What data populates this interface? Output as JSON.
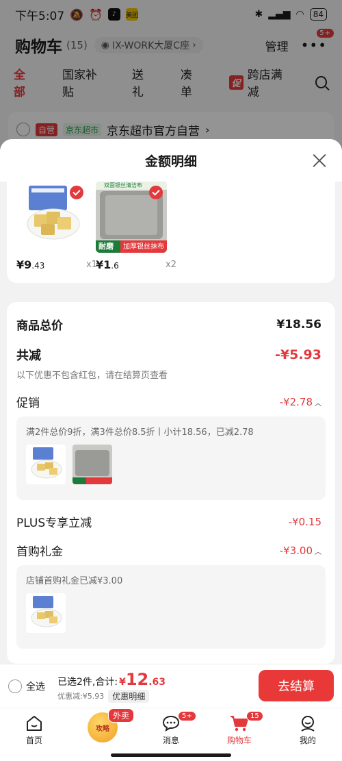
{
  "status_bar": {
    "time": "下午5:07",
    "app_badge": "美团",
    "battery": "84"
  },
  "cart": {
    "title": "购物车",
    "count": "(15)",
    "address": "IX-WORK大厦C座",
    "manage": "管理",
    "more_badge": "5+"
  },
  "tabs": [
    {
      "label": "全部"
    },
    {
      "label": "国家补贴"
    },
    {
      "label": "送礼"
    },
    {
      "label": "凑单"
    },
    {
      "label": "跨店满减",
      "tag": "促"
    }
  ],
  "store": {
    "tag_self": "自营",
    "tag_super": "京东超市",
    "name": "京东超市官方自营"
  },
  "sheet": {
    "title": "金额明细",
    "products": [
      {
        "price_int": "¥9",
        "price_dec": ".43",
        "qty": "x1"
      },
      {
        "price_int": "¥1",
        "price_dec": ".6",
        "qty": "x2",
        "label_left": "耐磨",
        "label_right": "加厚银丝抹布",
        "img_text": "双面银丝清洁布"
      }
    ],
    "total_label": "商品总价",
    "total_value": "¥18.56",
    "reduce_label": "共减",
    "reduce_value": "-¥5.93",
    "reduce_note": "以下优惠不包含红包，请在结算页查看",
    "promo_label": "促销",
    "promo_value": "-¥2.78",
    "promo_detail": "满2件总价9折，满3件总价8.5折丨小计18.56，已减2.78",
    "plus_label": "PLUS专享立减",
    "plus_value": "-¥0.15",
    "gift_label": "首购礼金",
    "gift_value": "-¥3.00",
    "gift_detail": "店铺首购礼金已减¥3.00"
  },
  "checkout": {
    "select_all": "全选",
    "selected_text": "已选2件,合计:",
    "total_currency": "¥",
    "total_int": "12",
    "total_dec": ".63",
    "discount_text": "优惠减:¥5.93",
    "detail_link": "优惠明细",
    "pay_button": "去结算"
  },
  "bottom_nav": [
    {
      "label": "首页",
      "icon": "home-icon"
    },
    {
      "label": "",
      "icon": "promo-icon",
      "badge": "外卖",
      "inner": "攻略"
    },
    {
      "label": "消息",
      "icon": "message-icon",
      "badge": "5+"
    },
    {
      "label": "购物车",
      "icon": "cart-icon",
      "badge": "15"
    },
    {
      "label": "我的",
      "icon": "profile-icon"
    }
  ],
  "colors": {
    "accent": "#e4393c",
    "pay_button": "#e83838",
    "background": "#f2f2f2"
  }
}
